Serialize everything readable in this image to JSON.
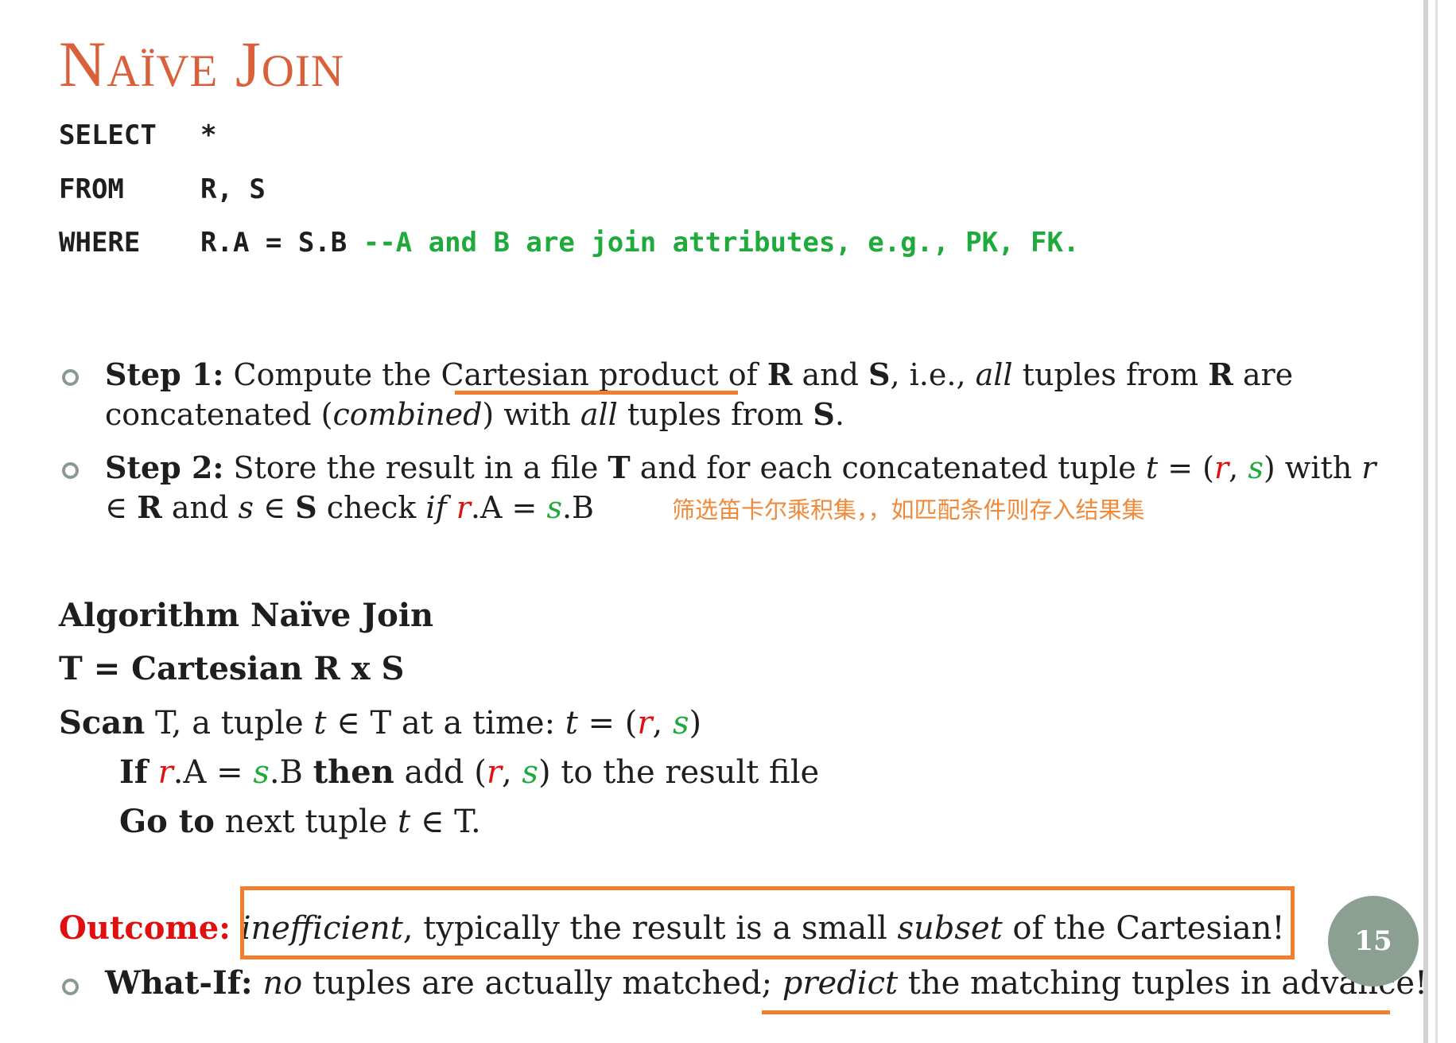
{
  "title": "Naïve Join",
  "sql": {
    "select_kw": "SELECT",
    "select_val": "*",
    "from_kw": "FROM",
    "from_val": "R, S",
    "where_kw": "WHERE",
    "where_val": "R.A = S.B",
    "where_comment": "--A and B are join attributes, e.g., PK, FK."
  },
  "step1": {
    "label": "Step 1:",
    "t1": " Compute the ",
    "t2": "Cartesian product ",
    "t3": "of ",
    "R": "R",
    "t4": " and ",
    "S": "S",
    "t5": ", i.e., ",
    "all": "all",
    "t6": " tuples from ",
    "R2": "R",
    "t7": " are",
    "l2a": "concatenated (",
    "combined": "combined",
    "l2b": ") with ",
    "all2": "all",
    "l2c": " tuples from ",
    "S2": "S",
    "l2d": "."
  },
  "step2": {
    "label": "Step 2:",
    "t1": " Store the result in a file ",
    "T": "T",
    "t2": " and for each concatenated tuple ",
    "t": "t",
    "t3": " = (",
    "r": "r",
    "comma": ", ",
    "s": "s",
    "t4": ") with ",
    "r2": "r",
    "l2a": "∈ ",
    "R": "R",
    "l2b": " and ",
    "s2": "s",
    "l2c": " ∈ ",
    "S": "S",
    "l2d": " check ",
    "if": "if",
    "l2e": " ",
    "r3": "r",
    "l2f": ".A = ",
    "s3": "s",
    "l2g": ".B"
  },
  "chinese_note": "筛选笛卡尔乘积集，，如匹配条件则存入结果集",
  "algorithm": {
    "heading": "Algorithm Naïve Join",
    "line1": "T = Cartesian R x S",
    "scan": "Scan",
    "scan_t1": " T, a tuple ",
    "t": "t",
    "scan_t2": " ∈ T at a time: ",
    "t2": "t",
    "scan_t3": " = (",
    "r": "r",
    "comma": ", ",
    "s": "s",
    "scan_t4": ")",
    "if_kw": "If",
    "if_sp": " ",
    "if_r": "r",
    "if_t1": ".A = ",
    "if_s": "s",
    "if_t2": ".B ",
    "then_kw": "then",
    "if_t3": " add (",
    "if_r2": "r",
    "if_comma": ", ",
    "if_s2": "s",
    "if_t4": ") to the result file",
    "goto_kw": "Go to",
    "goto_t1": " next tuple ",
    "goto_t": "t",
    "goto_t2": " ∈ T."
  },
  "outcome": {
    "label": "Outcome:",
    "sp": " ",
    "inefficient": "inefficient",
    "t1": ", typically the result is a small ",
    "subset": "subset",
    "t2": " of the Cartesian!"
  },
  "whatif": {
    "label": "What-If:",
    "sp": " ",
    "no": "no",
    "t1": " tuples are actually matched; ",
    "predict": "predict",
    "t2": " the matching tuples in advance!"
  },
  "page_number": "15",
  "colors": {
    "title": "#d9603b",
    "red": "#e01010",
    "green": "#1faa3c",
    "annotation": "#ef7f2c",
    "badge": "#8c9f93"
  }
}
